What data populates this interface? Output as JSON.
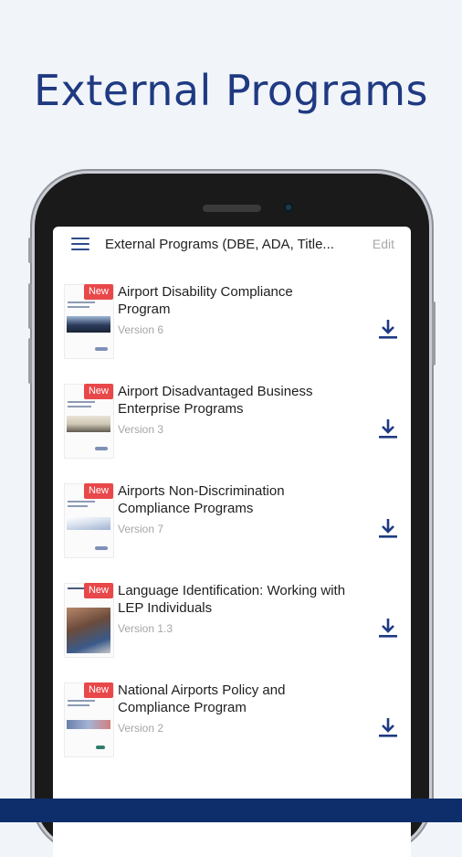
{
  "headline": "External Programs",
  "app": {
    "title": "External Programs (DBE, ADA, Title...",
    "edit_label": "Edit"
  },
  "colors": {
    "headline": "#1f3a82",
    "accent": "#1f3a82",
    "badge": "#e8484a",
    "bottom_bar": "#0d2e6b"
  },
  "icons": {
    "menu": "hamburger-menu-icon",
    "download": "download-icon"
  },
  "programs": [
    {
      "badge": "New",
      "title": "Airport Disability Compliance Program",
      "version": "Version 6"
    },
    {
      "badge": "New",
      "title": "Airport Disadvantaged Business Enterprise Programs",
      "version": "Version 3"
    },
    {
      "badge": "New",
      "title": "Airports Non-Discrimination Compliance Programs",
      "version": "Version 7"
    },
    {
      "badge": "New",
      "title": "Language Identification: Working with LEP Individuals",
      "version": "Version 1.3"
    },
    {
      "badge": "New",
      "title": "National Airports Policy and Compliance Program",
      "version": "Version 2"
    }
  ]
}
